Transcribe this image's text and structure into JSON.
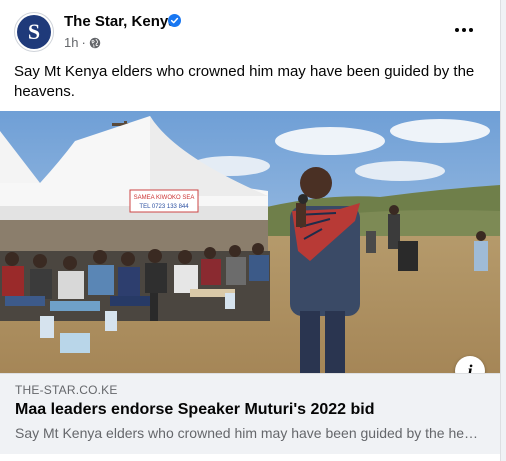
{
  "post": {
    "page_name": "The Star, Kenya",
    "avatar_letter": "S",
    "verified_icon": "verified-badge-icon",
    "time": "1h",
    "separator": "·",
    "privacy_icon": "globe-icon",
    "more_icon": "more-options-icon",
    "text": "Say Mt Kenya elders who crowned him may have been guided by the heavens."
  },
  "photo": {
    "tent_banner_line1": "SAMEA KIWOKO SEA",
    "tent_banner_line2": "TEL 0723 133 844"
  },
  "link_preview": {
    "info_icon": "i",
    "domain": "THE-STAR.CO.KE",
    "title": "Maa leaders endorse Speaker Muturi's 2022 bid",
    "description": "Say Mt Kenya elders who crowned him may have been guided by the heavens."
  },
  "colors": {
    "brand_blue": "#1877f2",
    "avatar_navy": "#1f3a7a",
    "secondary_text": "#65676b"
  }
}
